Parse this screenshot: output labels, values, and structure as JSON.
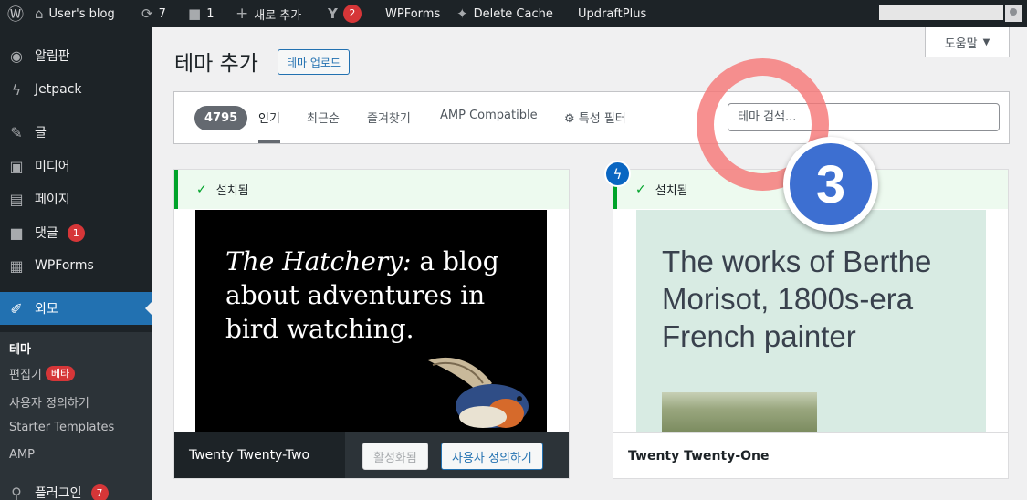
{
  "adminbar": {
    "wp_icon": "wordpress-icon",
    "site_name": "User's blog",
    "updates_count": "7",
    "comments_count": "1",
    "new_label": "새로 추가",
    "yoast_badge": "2",
    "wpforms": "WPForms",
    "delete_cache": "Delete Cache",
    "updraft": "UpdraftPlus"
  },
  "sidebar": {
    "dashboard": "알림판",
    "jetpack": "Jetpack",
    "posts": "글",
    "media": "미디어",
    "pages": "페이지",
    "comments": "댓글",
    "comments_badge": "1",
    "wpforms": "WPForms",
    "appearance": "외모",
    "sub": {
      "themes": "테마",
      "editor": "편집기",
      "editor_badge": "베타",
      "customize": "사용자 정의하기",
      "starter": "Starter Templates",
      "amp": "AMP"
    },
    "plugins": "플러그인",
    "plugins_badge": "7"
  },
  "help_button": "도움말",
  "page": {
    "title": "테마 추가",
    "upload_button": "테마 업로드"
  },
  "filter": {
    "count": "4795",
    "tabs": [
      "인기",
      "최근순",
      "즐겨찾기",
      "AMP Compatible"
    ],
    "feature_filter": "특성 필터",
    "search_placeholder": "테마 검색..."
  },
  "themes": [
    {
      "installed_label": "설치됨",
      "preview_italic": "The Hatchery:",
      "preview_rest": " a blog about adventures in bird watching.",
      "name": "Twenty Twenty-Two",
      "activated_label": "활성화됨",
      "customize_label": "사용자 정의하기"
    },
    {
      "installed_label": "설치됨",
      "preview_text": "The works of Berthe Morisot, 1800s-era French painter",
      "name": "Twenty Twenty-One"
    }
  ],
  "annotation": {
    "step": "3"
  }
}
